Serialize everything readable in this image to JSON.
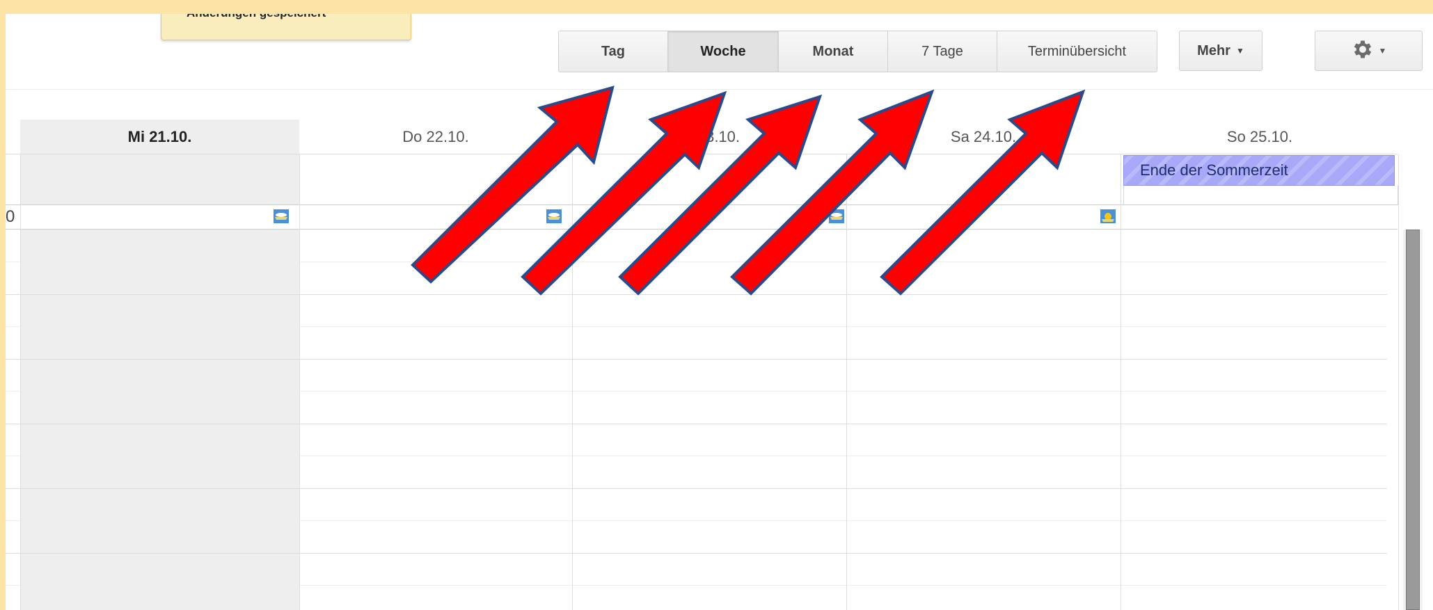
{
  "toast": {
    "text": "Änderungen gespeichert"
  },
  "toolbar": {
    "views": [
      {
        "label": "Tag",
        "active": false
      },
      {
        "label": "Woche",
        "active": true
      },
      {
        "label": "Monat",
        "active": false
      },
      {
        "label": "7 Tage",
        "active": false
      },
      {
        "label": "Terminübersicht",
        "active": false
      }
    ],
    "more_label": "Mehr",
    "settings_icon": "gear-icon"
  },
  "calendar": {
    "time_label": "0",
    "days": [
      {
        "label": "Mi 21.10.",
        "today": true
      },
      {
        "label": "Do 22.10.",
        "today": false
      },
      {
        "label": "Fr 23.10.",
        "today": false
      },
      {
        "label": "Sa 24.10.",
        "today": false
      },
      {
        "label": "So 25.10.",
        "today": false
      }
    ],
    "allday_event": {
      "title": "Ende der Sommerzeit",
      "day": "So 25.10.",
      "color": "#a7a8f7"
    },
    "weather_icons": [
      "weather-cloud-icon",
      "weather-cloud-icon",
      "weather-cloud-icon",
      "weather-sun-icon"
    ]
  },
  "annotations": {
    "arrow_color": "#ff0000",
    "arrow_outline": "#2a4a8a",
    "icon": "red-arrow-icon"
  }
}
